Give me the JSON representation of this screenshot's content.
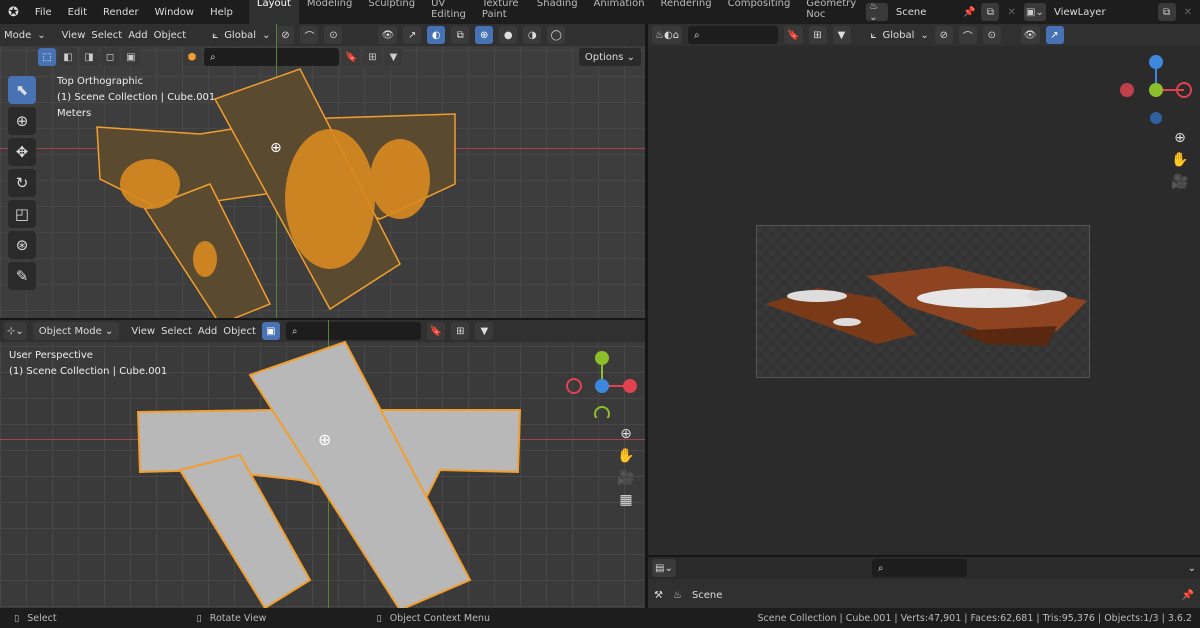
{
  "topbar": {
    "menus": [
      "File",
      "Edit",
      "Render",
      "Window",
      "Help"
    ],
    "workspaces": [
      "Layout",
      "Modeling",
      "Sculpting",
      "UV Editing",
      "Texture Paint",
      "Shading",
      "Animation",
      "Rendering",
      "Compositing",
      "Geometry Noc"
    ],
    "active_workspace": "Layout",
    "scene": "Scene",
    "view_layer": "ViewLayer"
  },
  "viewport_top": {
    "mode": "Mode",
    "menus": [
      "View",
      "Select",
      "Add",
      "Object"
    ],
    "orientation": "Global",
    "options": "Options",
    "overlay": [
      "Top Orthographic",
      "(1) Scene Collection | Cube.001",
      "Meters"
    ]
  },
  "viewport_bottom": {
    "mode": "Object Mode",
    "menus": [
      "View",
      "Select",
      "Add",
      "Object"
    ],
    "overlay": [
      "User Perspective",
      "(1) Scene Collection | Cube.001"
    ]
  },
  "viewport_right": {
    "orientation": "Global"
  },
  "properties": {
    "tab": "Scene"
  },
  "status": {
    "left": [
      "Select",
      "Rotate View",
      "Object Context Menu"
    ],
    "right": "Scene Collection | Cube.001 | Verts:47,901 | Faces:62,681 | Tris:95,376 | Objects:1/3 | 3.6.2"
  },
  "colors": {
    "accent": "#4772b3",
    "selection": "#f29e2e",
    "x_axis": "#e0424f",
    "y_axis": "#8cbf2a",
    "z_axis": "#3d88de"
  }
}
